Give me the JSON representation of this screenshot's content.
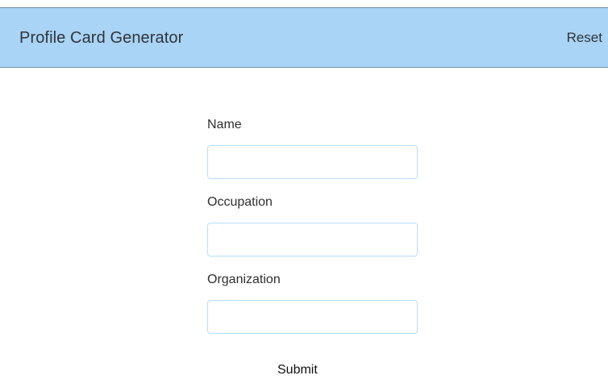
{
  "header": {
    "title": "Profile Card Generator",
    "reset_label": "Reset"
  },
  "form": {
    "fields": [
      {
        "label": "Name",
        "value": "",
        "placeholder": ""
      },
      {
        "label": "Occupation",
        "value": "",
        "placeholder": ""
      },
      {
        "label": "Organization",
        "value": "",
        "placeholder": ""
      }
    ],
    "submit_label": "Submit"
  },
  "colors": {
    "header_background": "#a9d4f5",
    "input_border": "#b9ddf8",
    "text": "#2f2f2f"
  }
}
